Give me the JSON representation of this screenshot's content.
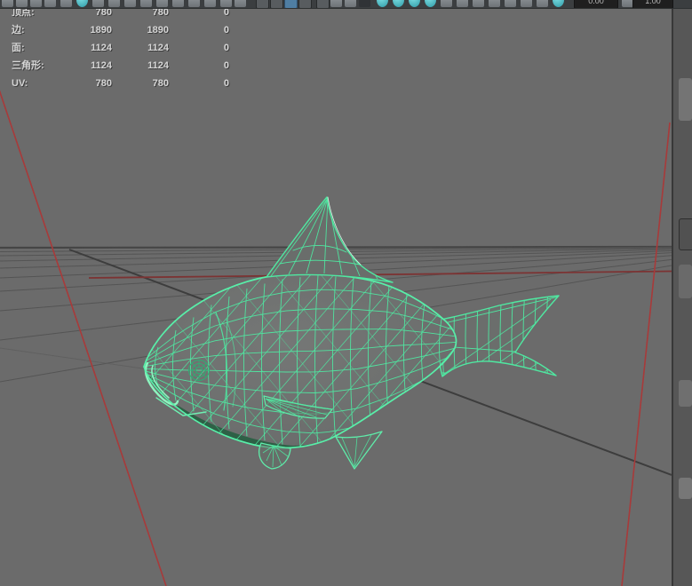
{
  "toolbar": {
    "field1": "0.00",
    "field2": "1.00"
  },
  "hud": {
    "rows": [
      {
        "label": "顶点:",
        "col1": "780",
        "col2": "780",
        "col3": "0"
      },
      {
        "label": "边:",
        "col1": "1890",
        "col2": "1890",
        "col3": "0"
      },
      {
        "label": "面:",
        "col1": "1124",
        "col2": "1124",
        "col3": "0"
      },
      {
        "label": "三角形:",
        "col1": "1124",
        "col2": "1124",
        "col3": "0"
      },
      {
        "label": "UV:",
        "col1": "780",
        "col2": "780",
        "col3": "0"
      }
    ]
  },
  "viewport": {
    "content_description": "green wireframe fish polygon mesh on perspective ground grid",
    "background_color": "#6b6b6b",
    "wireframe_color": "#4fe8a1",
    "wireframe_highlight_color": "#8df5bf",
    "grid_line_color": "#525252",
    "grid_horizon_color": "#454545",
    "axis_x_color": "#7c3333",
    "camera_frustum_color": "#a83a3a"
  }
}
